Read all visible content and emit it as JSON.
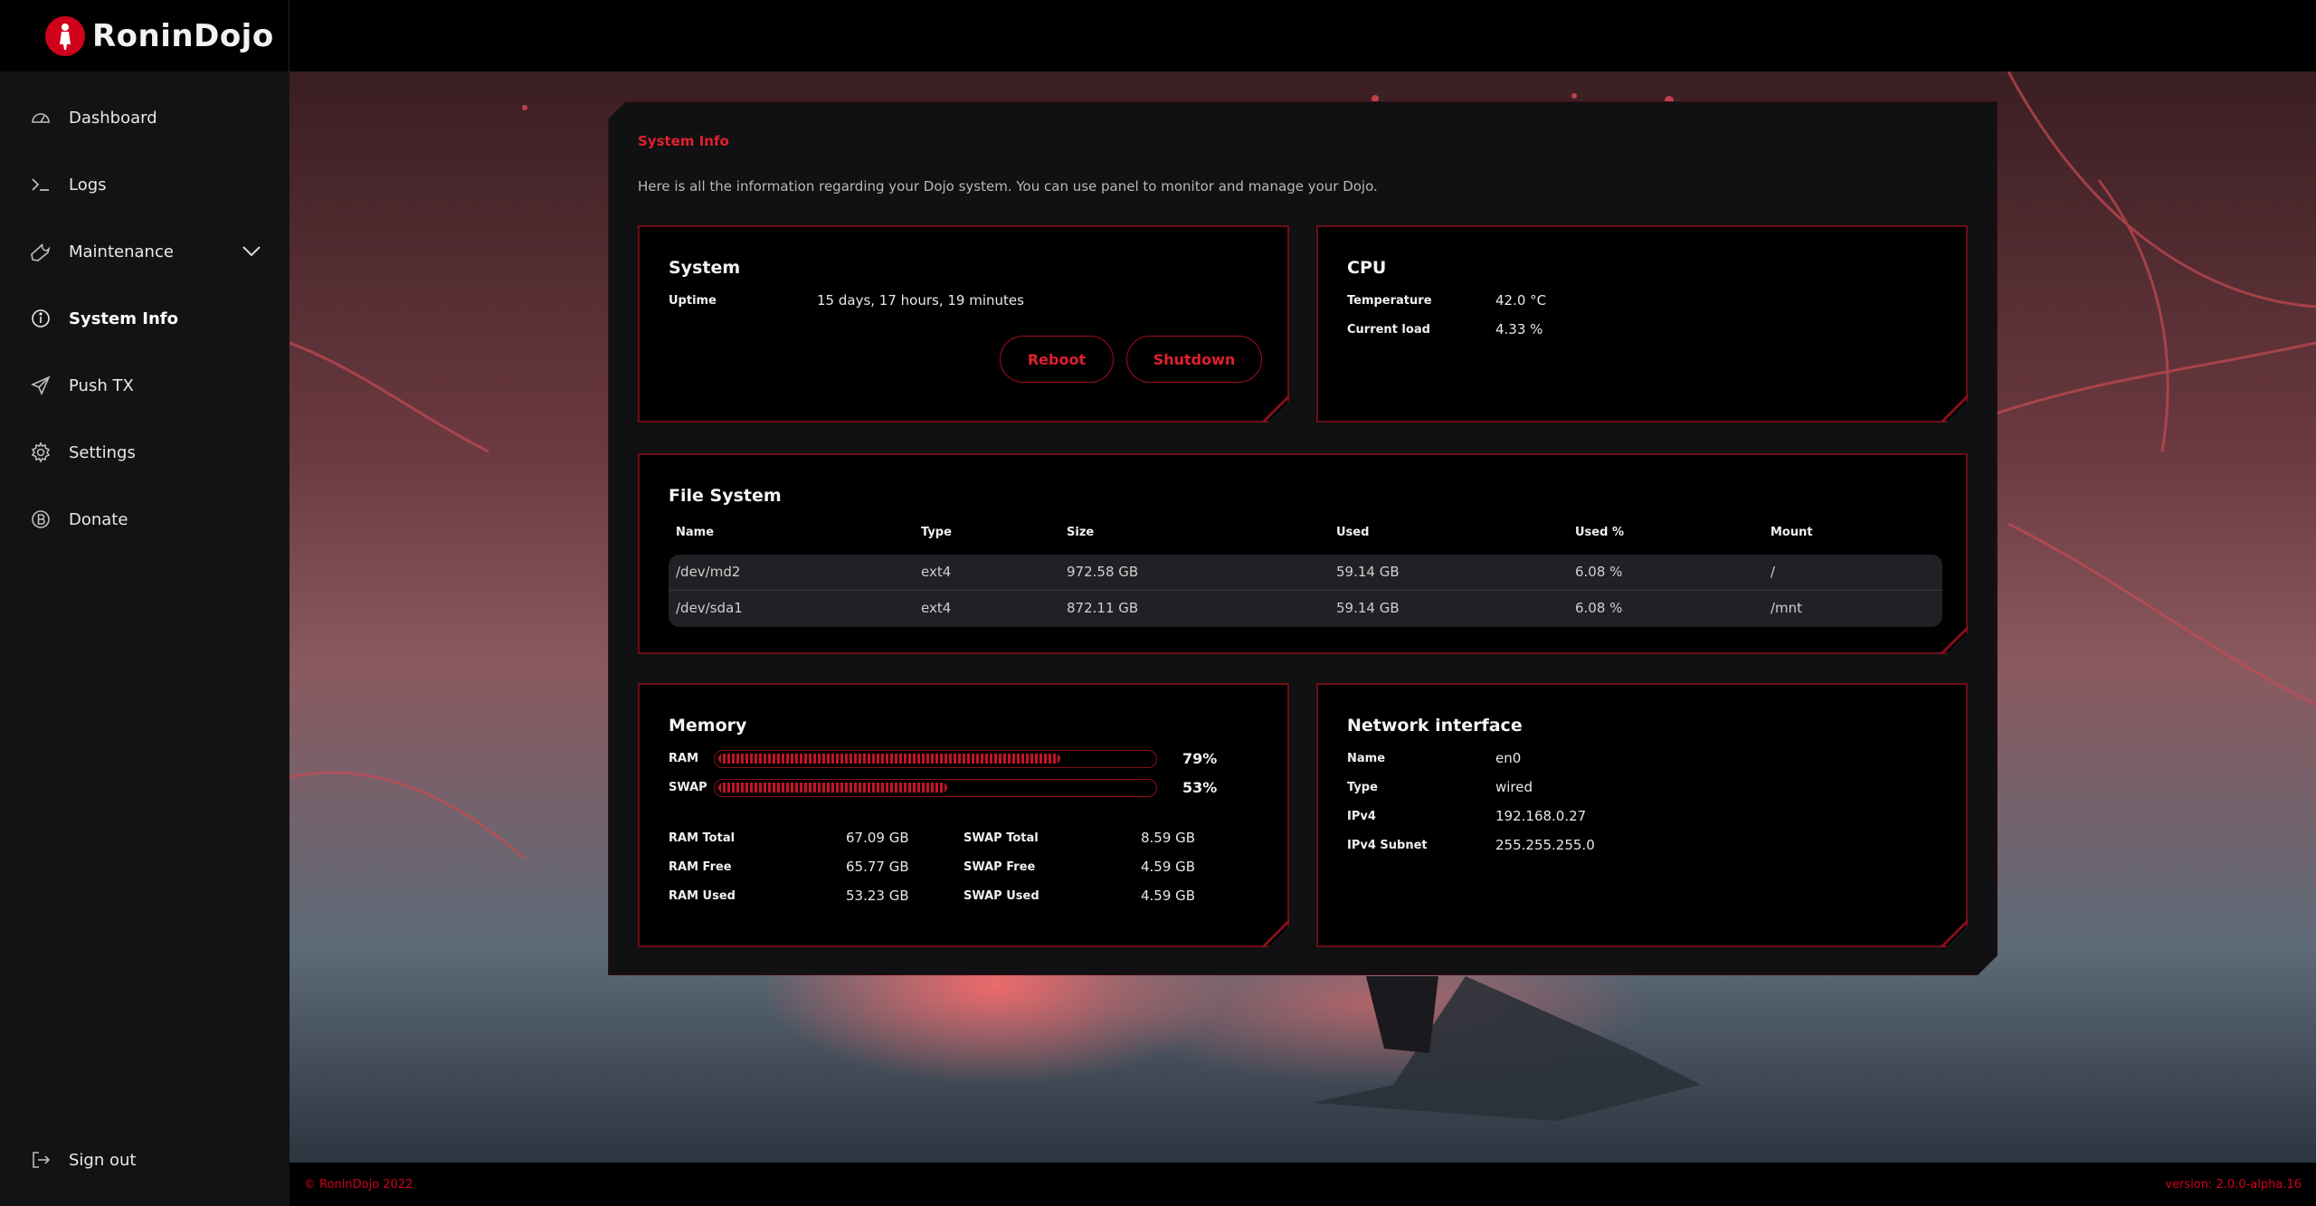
{
  "app": {
    "name": "RoninDojo"
  },
  "sidebar": {
    "items": [
      {
        "label": "Dashboard",
        "icon": "dashboard-icon"
      },
      {
        "label": "Logs",
        "icon": "terminal-icon"
      },
      {
        "label": "Maintenance",
        "icon": "wrench-icon"
      },
      {
        "label": "System Info",
        "icon": "info-icon"
      },
      {
        "label": "Push TX",
        "icon": "send-icon"
      },
      {
        "label": "Settings",
        "icon": "gear-icon"
      },
      {
        "label": "Donate",
        "icon": "bitcoin-icon"
      }
    ],
    "active": "System Info",
    "signout_label": "Sign out"
  },
  "panel": {
    "title": "System Info",
    "description": "Here is all the information regarding your Dojo system. You can use panel to monitor and manage your Dojo."
  },
  "system": {
    "title": "System",
    "uptime_label": "Uptime",
    "uptime_value": "15 days, 17 hours, 19 minutes",
    "reboot_label": "Reboot",
    "shutdown_label": "Shutdown"
  },
  "cpu": {
    "title": "CPU",
    "temp_label": "Temperature",
    "temp_value": "42.0 °C",
    "load_label": "Current load",
    "load_value": "4.33 %"
  },
  "filesystem": {
    "title": "File System",
    "columns": [
      "Name",
      "Type",
      "Size",
      "Used",
      "Used %",
      "Mount"
    ],
    "rows": [
      [
        "/dev/md2",
        "ext4",
        "972.58 GB",
        "59.14 GB",
        "6.08 %",
        "/"
      ],
      [
        "/dev/sda1",
        "ext4",
        "872.11 GB",
        "59.14 GB",
        "6.08 %",
        "/mnt"
      ]
    ]
  },
  "memory": {
    "title": "Memory",
    "ram_label": "RAM",
    "ram_pct": "79%",
    "ram_fraction": 0.79,
    "swap_label": "SWAP",
    "swap_pct": "53%",
    "swap_fraction": 0.53,
    "ram_total_label": "RAM Total",
    "ram_total": "67.09 GB",
    "ram_free_label": "RAM Free",
    "ram_free": "65.77 GB",
    "ram_used_label": "RAM Used",
    "ram_used": "53.23 GB",
    "swap_total_label": "SWAP Total",
    "swap_total": "8.59 GB",
    "swap_free_label": "SWAP Free",
    "swap_free": "4.59 GB",
    "swap_used_label": "SWAP Used",
    "swap_used": "4.59 GB"
  },
  "network": {
    "title": "Network interface",
    "name_label": "Name",
    "name_value": "en0",
    "type_label": "Type",
    "type_value": "wired",
    "ipv4_label": "IPv4",
    "ipv4_value": "192.168.0.27",
    "subnet_label": "IPv4 Subnet",
    "subnet_value": "255.255.255.0"
  },
  "footer": {
    "copyright": "© RoninDojo 2022",
    "version": "version: 2.0.0-alpha.16"
  },
  "colors": {
    "accent": "#d0021b",
    "panel": "#111113",
    "card": "#000000",
    "sidebar": "#131313"
  }
}
